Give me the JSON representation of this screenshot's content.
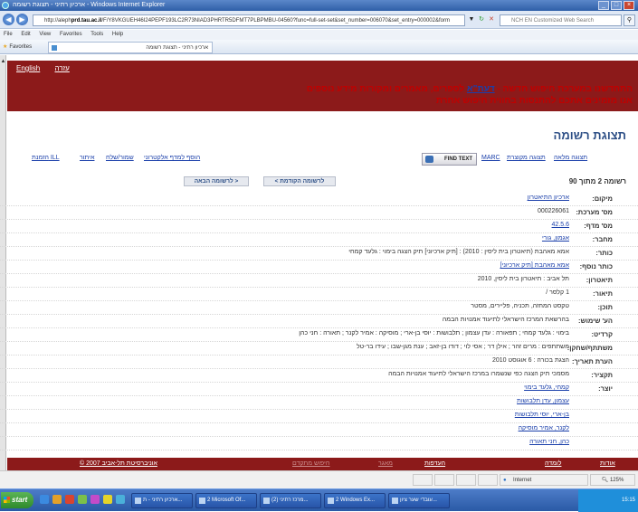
{
  "window": {
    "title": "ארכיון רתיני - תצוגת רשומה - Windows Internet Explorer"
  },
  "browser": {
    "url_prefix": "http://aleph",
    "url_host": "prd.tau.ac.il",
    "url_path": "/F/Y8VKGUEH46I24PEPF193LC2R73NIAD3PHRTR5DFMT7PLBPMBU-04560?func=full-set-set&set_number=006070&set_entry=000002&form",
    "search_placeholder": "NCH EN Customized Web Search",
    "menu": [
      "File",
      "Edit",
      "View",
      "Favorites",
      "Tools",
      "Help"
    ],
    "favorites_label": "Favorites",
    "tab_title": "ארכיון רתיני - תצוגת רשומה"
  },
  "banner": {
    "link_english": "English",
    "link_help": "עזרה",
    "msg_line1_pre": "התחדשנו במערכת חיפוש חדשה - ",
    "msg_line1_link": "דעת\"א",
    "msg_line1_post": " לספרים, מאמרים ומקורות מידע נוספים",
    "msg_line2": "אנו מזמינים אתכם להתנסות בחווית חיפוש אחרת"
  },
  "page": {
    "heading": "תצוגת רשומה",
    "record_count": "רשומה 2 מתוך 90"
  },
  "toolbar": {
    "full_view": "תצוגה מלאה",
    "source_view": "תצוגה מקוצרת",
    "marc": "MARC",
    "find_text": "FIND TEXT",
    "add_to_shelf": "הוסף למדף אלקטרוני",
    "save_mail": "שמור/שלח",
    "locate": "איתור",
    "ill_order": "הזמנת ILL"
  },
  "nav": {
    "prev": "< לרשומה הקודמת",
    "next": "לרשומה הבאה >"
  },
  "record": {
    "rows": [
      {
        "label": "מיקום:",
        "value": "ארכיון התיאטרון",
        "link": true
      },
      {
        "label": "מס' מערכת:",
        "value": "000226061",
        "link": false
      },
      {
        "label": "מס' מדף:",
        "value": "42.5.6",
        "link": true
      },
      {
        "label": "מחבר:",
        "value": "אגמון, גורי",
        "link": true
      },
      {
        "label": "כותר:",
        "value": "אמא מאהבת (תיאטרון בית ליסין : 2010) : [תיק ארכיוני] תיק הצגה בימוי : גלעד קמחי",
        "link": false
      },
      {
        "label": "כותר נוסף:",
        "value": "אמא מאהבת [תיק ארכיוני]",
        "link": true
      },
      {
        "label": "תיאטרון:",
        "value": "תל אביב : תיאטרון בית ליסין, 2010",
        "link": false
      },
      {
        "label": "תיאור:",
        "value": "1 קלסר / ",
        "link": false
      },
      {
        "label": "תוכן:",
        "value": "טקסט המחזה, תכניה, פליירים, מסטר",
        "link": false
      },
      {
        "label": "הע' שימוש:",
        "value": "בהרשאת המרכז הישראלי לתיעוד אמנויות הבמה",
        "link": false
      },
      {
        "label": "קרדיט:",
        "value": "בימוי : גלעד קמחי ; תפאורה : עדן עצמון ; תלבושות : יוסי בן-ארי ; מוסיקה : אמיר לקנר ; תאורה : חני כהן",
        "link": false
      },
      {
        "label": "משתתף/שחקן:",
        "value": "משתתפים : מרים זהר ; אילן דר ; אסי לוי ; דודו בן-זאב ; ענת מגן-שבו ; עידו בר-טל",
        "link": false
      },
      {
        "label": "הערת תאריך:",
        "value": "הצגת בכורה : 6 אוגוסט 2010",
        "link": false
      },
      {
        "label": "תקציר:",
        "value": "מסמכי תיק הצגה כפי שנשמרו במרכז הישראלי לתיעוד אמנויות הבמה",
        "link": false
      },
      {
        "label": "יוצר:",
        "value": "קמחי, גלעד בימוי",
        "link": true
      },
      {
        "label": "",
        "value": "עצמון, עדן תלבושות",
        "link": true
      },
      {
        "label": "",
        "value": "בן-ארי, יוסי תלבושות",
        "link": true
      },
      {
        "label": "",
        "value": "לקנר, אמיר מוסיקה",
        "link": true
      },
      {
        "label": "",
        "value": "כהן, חני תאורה",
        "link": true
      }
    ]
  },
  "footer": {
    "copyright": "© 2007 אוניברסיטת תל-אביב",
    "links": [
      "אודות",
      "לומדה",
      "העדפות",
      "מאגר",
      "חיפוש מתקדם"
    ]
  },
  "status": {
    "zone": "Internet",
    "zoom": "125%"
  },
  "taskbar": {
    "start": "start",
    "tasks": [
      "ארכיון רתיני - ת...",
      "2 Microsoft Of...",
      "(2) מרכז רתיני...",
      "2 Windows Ex...",
      "עובדי שער ציון..."
    ],
    "clock": "15:15"
  }
}
